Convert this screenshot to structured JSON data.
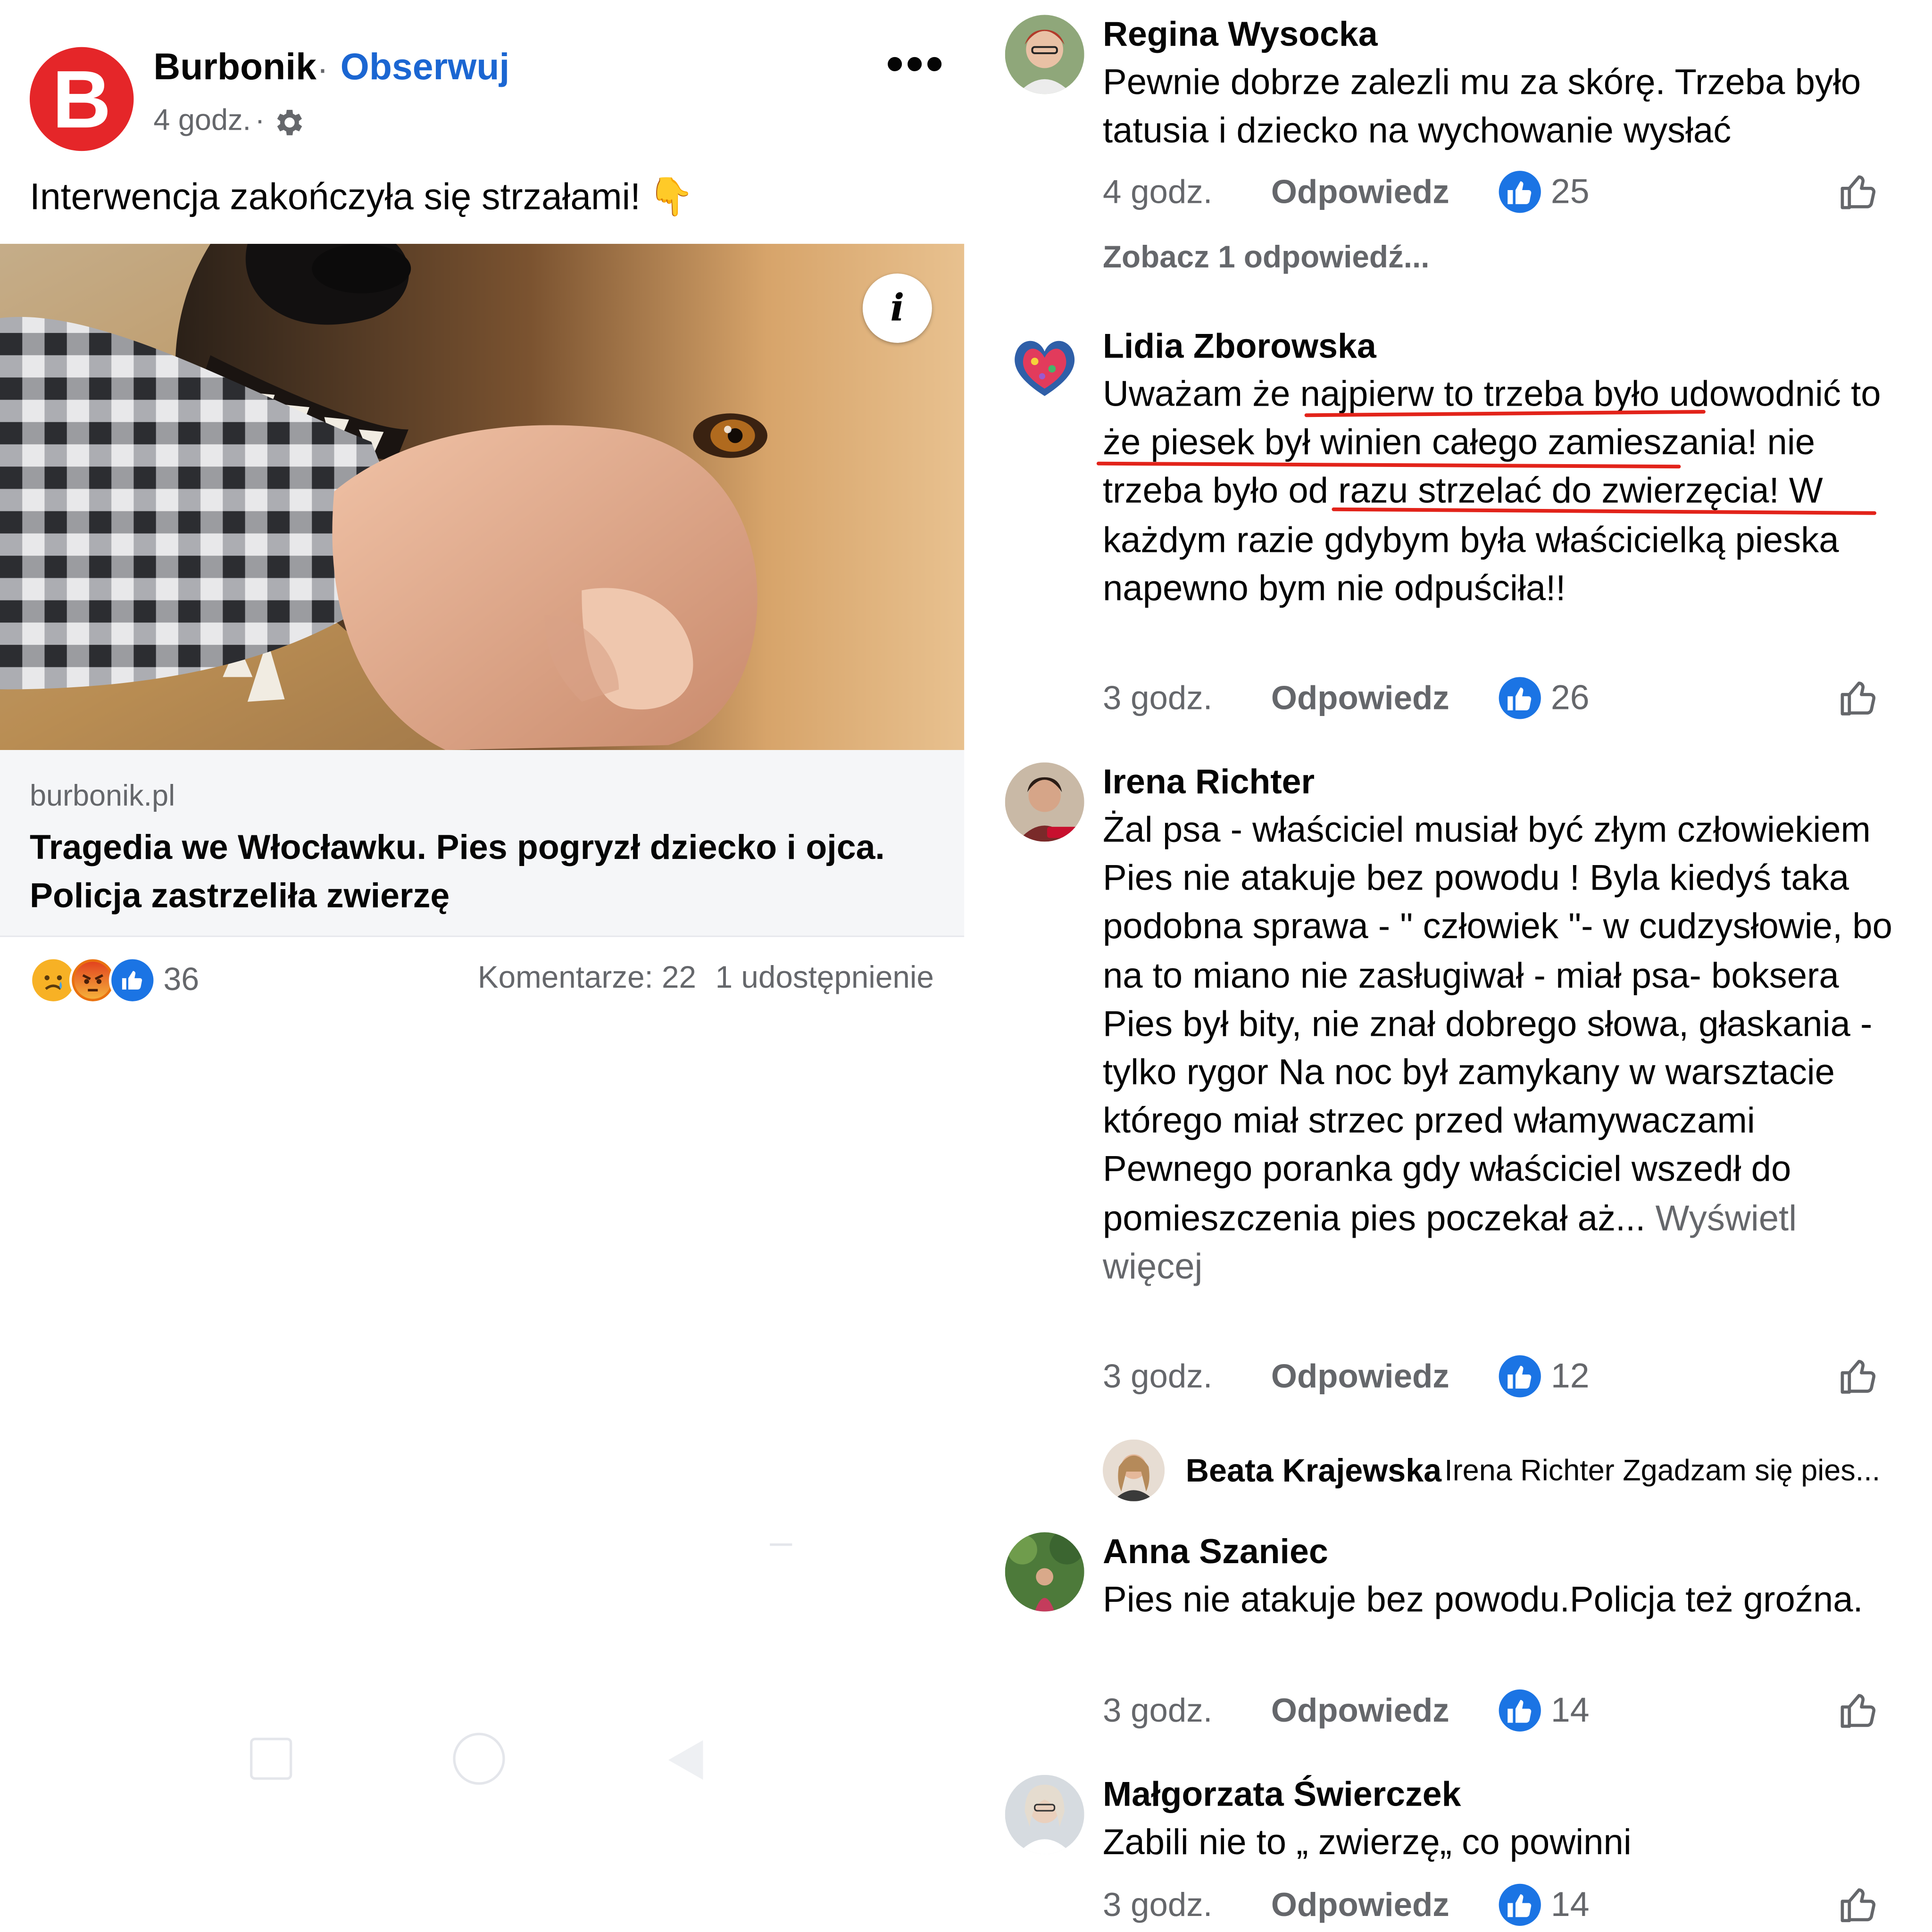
{
  "post": {
    "page_name": "Burbonik",
    "avatar_letter": "B",
    "separator": "·",
    "follow_label": "Obserwuj",
    "time": "4 godz.",
    "time_separator": "·",
    "more_label": "•••",
    "caption": "Interwencja zakończyła się strzałami!",
    "caption_emoji": "👇",
    "info_label": "i",
    "link_domain": "burbonik.pl",
    "link_title": "Tragedia we Włocławku. Pies pogryzł dziecko i ojca. Policja zastrzeliła zwierzę",
    "reaction_count": "36",
    "comments_label": "Komentarze: 22",
    "shares_label": "1 udostępnienie",
    "colors": {
      "brand_red": "#e52629",
      "link_blue": "#1b66d2",
      "like_blue": "#1b74e4",
      "underline_red": "#e2231a"
    }
  },
  "comments": [
    {
      "author": "Regina Wysocka",
      "text": "Pewnie dobrze zalezli mu za skórę. Trzeba było tatusia i dziecko  na wychowanie wysłać",
      "time": "4 godz.",
      "reply_label": "Odpowiedz",
      "likes": "25",
      "see_replies": "Zobacz 1 odpowiedź..."
    },
    {
      "author": "Lidia Zborowska",
      "text": "Uważam że najpierw to trzeba było udowodnić to że piesek był winien całego zamieszania! nie trzeba było od razu strzelać do zwierzęcia! W każdym razie gdybym była właścicielką pieska napewno bym nie odpuściła!!",
      "time": "3 godz.",
      "reply_label": "Odpowiedz",
      "likes": "26"
    },
    {
      "author": "Irena Richter",
      "text": "Żal psa - właściciel musiał być złym człowiekiem Pies nie atakuje bez powodu ! Byla kiedyś taka podobna sprawa - \" człowiek \"- w cudzysłowie, bo na to miano nie zasługiwał - miał psa- boksera Pies był bity, nie znał dobrego słowa, głaskania - tylko rygor Na noc był zamykany w warsztacie którego miał strzec przed włamywaczami Pewnego poranka gdy właściciel wszedł do pomieszczenia pies poczekał aż...",
      "see_more": " Wyświetl więcej",
      "time": "3 godz.",
      "reply_label": "Odpowiedz",
      "likes": "12",
      "reply_preview": {
        "author": "Beata Krajewska",
        "text": "Irena Richter Zgadzam się pies..."
      }
    },
    {
      "author": "Anna Szaniec",
      "text": "Pies nie atakuje bez powodu.Policja też groźna.",
      "time": "3 godz.",
      "reply_label": "Odpowiedz",
      "likes": "14"
    },
    {
      "author": "Małgorzata Świerczek",
      "text": "Zabili nie to „ zwierzę„ co powinni",
      "time": "3 godz.",
      "reply_label": "Odpowiedz",
      "likes": "14"
    }
  ],
  "icons": {
    "gear": "gear-icon",
    "more": "more-options-icon",
    "info": "info-icon",
    "reaction_sad": "sad-reaction-icon",
    "reaction_angry": "angry-reaction-icon",
    "reaction_like": "like-reaction-icon",
    "like_button": "thumbs-up-outline-icon"
  }
}
